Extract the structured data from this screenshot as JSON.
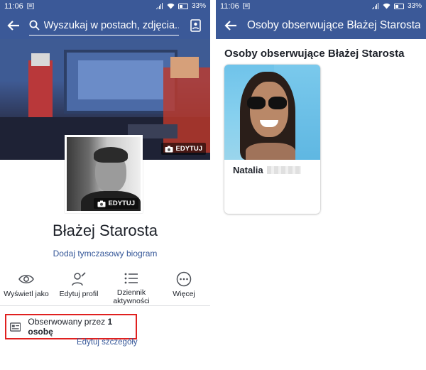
{
  "status": {
    "time": "11:06",
    "battery": "33%"
  },
  "left": {
    "search_placeholder": "Wyszukaj w postach, zdjęcia...",
    "edit_cover": "EDYTUJ",
    "edit_avatar": "EDYTUJ",
    "profile_name": "Błażej Starosta",
    "bio_link": "Dodaj tymczasowy biogram",
    "actions": [
      {
        "label": "Wyświetl jako",
        "icon": "eye-icon"
      },
      {
        "label": "Edytuj profil",
        "icon": "edit-profile-icon"
      },
      {
        "label": "Dziennik aktywności",
        "icon": "list-icon"
      },
      {
        "label": "Więcej",
        "icon": "more-icon"
      }
    ],
    "followed_prefix": "Obserwowany przez ",
    "followed_count": "1 osobę",
    "edit_details": "Edytuj szczegóły"
  },
  "right": {
    "appbar_title": "Osoby obserwujące Błażej Starosta",
    "section_title": "Osoby obserwujące Błażej Starosta",
    "follower_name": "Natalia"
  },
  "colors": {
    "brand": "#3b5998",
    "link": "#365899",
    "highlight": "#e0201f"
  }
}
